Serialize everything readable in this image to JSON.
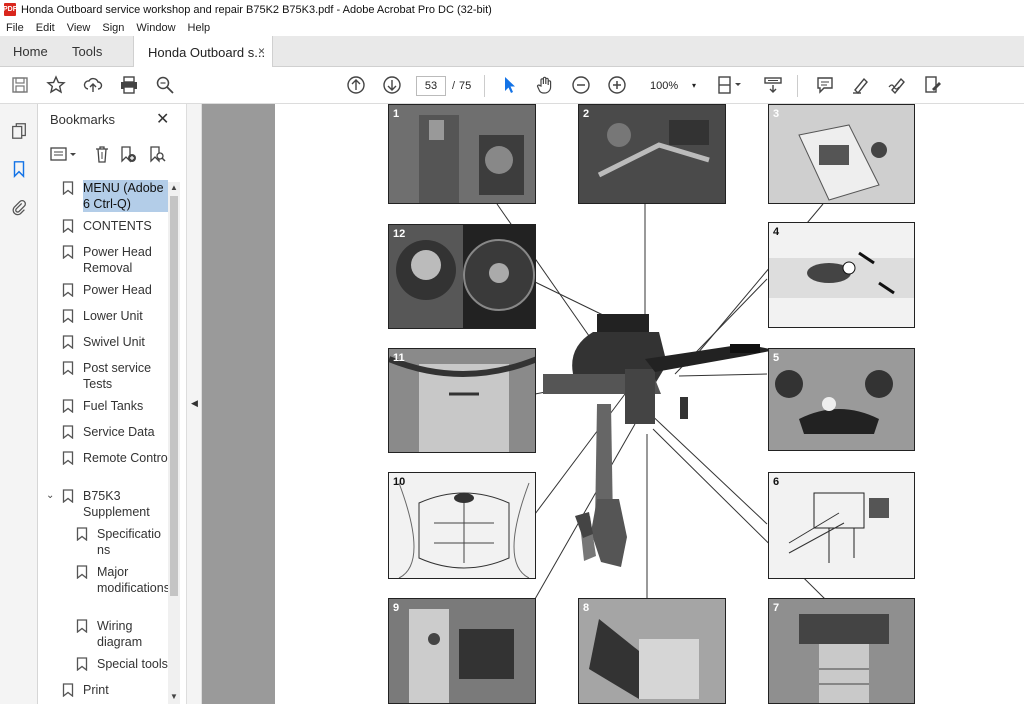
{
  "window": {
    "title": "Honda Outboard service workshop and repair B75K2 B75K3.pdf - Adobe Acrobat Pro DC (32-bit)",
    "app_icon_text": "PDF"
  },
  "menu": [
    "File",
    "Edit",
    "View",
    "Sign",
    "Window",
    "Help"
  ],
  "tabs": {
    "home": "Home",
    "tools": "Tools",
    "doc": "Honda Outboard s...",
    "close": "×"
  },
  "toolbar": {
    "page_current": "53",
    "page_sep": "/",
    "page_total": "75",
    "zoom": "100%",
    "zoom_caret": "▾"
  },
  "bookmarks": {
    "title": "Bookmarks",
    "close": "✕",
    "items": [
      {
        "label": "MENU (Adobe 6 Ctrl-Q)"
      },
      {
        "label": "CONTENTS"
      },
      {
        "label": "Power Head Removal"
      },
      {
        "label": "Power Head"
      },
      {
        "label": "Lower Unit"
      },
      {
        "label": "Swivel Unit"
      },
      {
        "label": "Post service Tests"
      },
      {
        "label": "Fuel Tanks"
      },
      {
        "label": "Service Data"
      },
      {
        "label": "Remote Control"
      },
      {
        "label": "B75K3 Supplement"
      },
      {
        "label": "Specifications"
      },
      {
        "label": "Major modifications"
      },
      {
        "label": "Wiring diagram"
      },
      {
        "label": "Special tools"
      },
      {
        "label": "Print"
      }
    ]
  },
  "figure": {
    "panels": [
      "1",
      "2",
      "3",
      "4",
      "5",
      "6",
      "7",
      "8",
      "9",
      "10",
      "11",
      "12"
    ]
  }
}
